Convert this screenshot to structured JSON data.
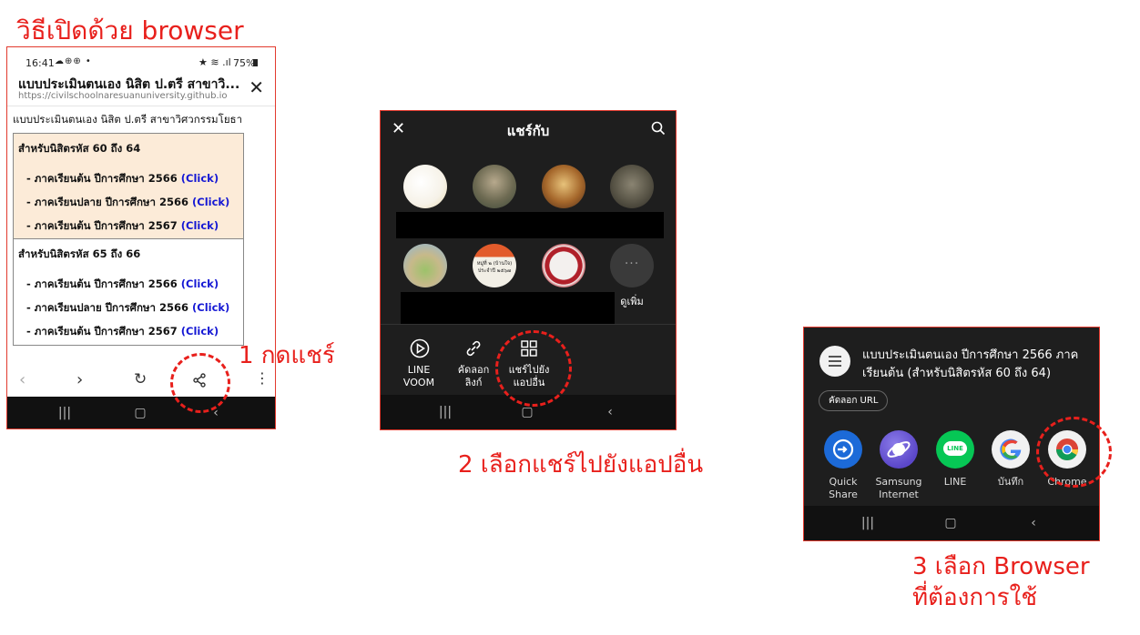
{
  "heading": "วิธีเปิดด้วย browser",
  "step1": {
    "label": "1 กดแชร์"
  },
  "step2": {
    "label": "2 เลือกแชร์ไปยังแอปอื่น"
  },
  "step3": {
    "line1": "3 เลือก Browser",
    "line2": "ที่ต้องการใช้"
  },
  "phone1": {
    "time": "16:41",
    "battery": "75%",
    "header_title": "แบบประเมินตนเอง นิสิต ป.ตรี สาขาวิ...",
    "header_url": "https://civilschoolnaresuanuniversity.github.io",
    "page_heading": "แบบประเมินตนเอง นิสิต ป.ตรี สาขาวิศวกรรมโยธา",
    "group1": {
      "title": "สำหรับนิสิตรหัส 60 ถึง 64",
      "rows": [
        {
          "text": "-  ภาคเรียนต้น ปีการศึกษา 2566",
          "link": "(Click)"
        },
        {
          "text": "-  ภาคเรียนปลาย ปีการศึกษา 2566",
          "link": "(Click)"
        },
        {
          "text": "-  ภาคเรียนต้น ปีการศึกษา 2567",
          "link": "(Click)"
        }
      ]
    },
    "group2": {
      "title": "สำหรับนิสิตรหัส 65 ถึง 66",
      "rows": [
        {
          "text": "-  ภาคเรียนต้น ปีการศึกษา 2566",
          "link": "(Click)"
        },
        {
          "text": "-  ภาคเรียนปลาย ปีการศึกษา 2566",
          "link": "(Click)"
        },
        {
          "text": "-  ภาคเรียนต้น ปีการศึกษา 2567",
          "link": "(Click)"
        }
      ]
    }
  },
  "phone2": {
    "title": "แชร์กับ",
    "more_label": "ดูเพิ่ม",
    "actions": [
      {
        "line1": "LINE",
        "line2": "VOOM"
      },
      {
        "line1": "คัดลอก",
        "line2": "ลิงก์"
      },
      {
        "line1": "แชร์ไปยัง",
        "line2": "แอปอื่น"
      }
    ],
    "avatar_tiny_text": {
      "line1": "หมู่ที่ ๒ (บ้านใจ)",
      "line2": "ประจำปี ๒๕๖๗"
    }
  },
  "phone3": {
    "share_title_line1": "แบบประเมินตนเอง ปีการศึกษา 2566 ภาค",
    "share_title_line2": "เรียนต้น (สำหรับนิสิตรหัส 60 ถึง 64)",
    "copy_url": "คัดลอก URL",
    "apps": [
      {
        "line1": "Quick",
        "line2": "Share"
      },
      {
        "line1": "Samsung",
        "line2": "Internet"
      },
      {
        "line1": "LINE",
        "line2": ""
      },
      {
        "line1": "บันทึก",
        "line2": ""
      },
      {
        "line1": "Chrome",
        "line2": ""
      }
    ],
    "line_icon_text": "LINE"
  },
  "colors": {
    "accent_red": "#e8201c",
    "link_blue": "#1518d4",
    "dark_bg": "#1e1e1e"
  }
}
